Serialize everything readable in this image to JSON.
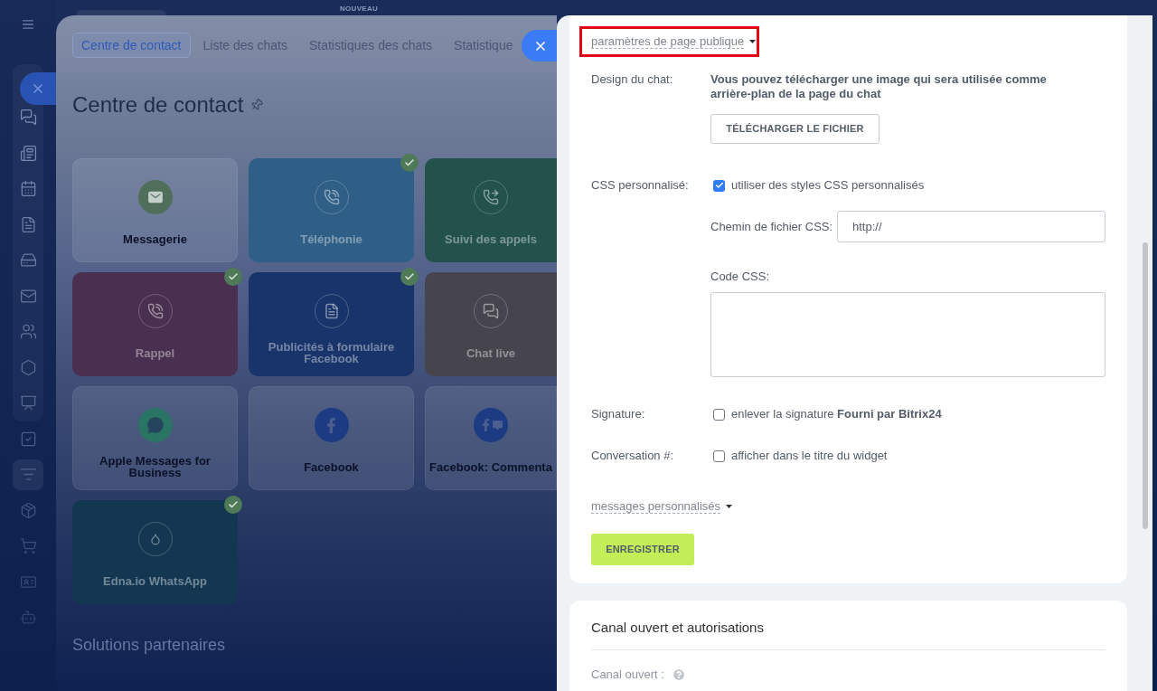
{
  "top_bar": {
    "badge": "NOUVEAU"
  },
  "sidebar": {
    "groups": [
      {
        "kind": "panel",
        "items": [
          {
            "selected": false
          },
          {
            "selected": false
          },
          {
            "selected": false
          },
          {
            "selected": false
          },
          {
            "selected": false
          },
          {
            "selected": false
          },
          {
            "selected": false
          },
          {
            "selected": false
          },
          {
            "selected": false
          }
        ]
      },
      {
        "kind": "plain",
        "items": [
          {
            "selected": false
          },
          {
            "selected": true
          },
          {
            "selected": false
          },
          {
            "selected": false
          },
          {
            "selected": false
          },
          {
            "selected": false
          }
        ]
      }
    ]
  },
  "contact_center": {
    "tabs": [
      {
        "label": "Centre de contact",
        "selected": true
      },
      {
        "label": "Liste des chats",
        "selected": false
      },
      {
        "label": "Statistiques des chats",
        "selected": false
      },
      {
        "label": "Statistique",
        "selected": false
      }
    ],
    "title": "Centre de contact",
    "tiles": [
      {
        "label": "Messagerie",
        "kind": "plain",
        "color": "#4f6f5b",
        "connected": false
      },
      {
        "label": "Téléphonie",
        "kind": "filled",
        "color": "#2f5e86",
        "connected": true
      },
      {
        "label": "Suivi des appels",
        "kind": "filled",
        "color": "#22524b",
        "connected": false
      },
      {
        "label": "Rappel",
        "kind": "filled",
        "color": "#4a3050",
        "connected": true
      },
      {
        "label": "Publicités à formulaire Facebook",
        "kind": "filled",
        "color": "#19346a",
        "connected": true
      },
      {
        "label": "Chat live",
        "kind": "filled",
        "color": "#46454e",
        "connected": false
      },
      {
        "label": "Apple Messages for Business",
        "kind": "plain",
        "color": "#2a7463",
        "connected": false
      },
      {
        "label": "Facebook",
        "kind": "plain",
        "color": "#1d3b82",
        "connected": false
      },
      {
        "label": "Facebook: Commenta",
        "kind": "plain",
        "color": "#1d3b82",
        "connected": false
      },
      {
        "label": "Edna.io WhatsApp",
        "kind": "filled",
        "color": "#133651",
        "connected": true
      }
    ],
    "section_title": "Solutions partenaires"
  },
  "settings": {
    "section_toggle": {
      "label": "paramètres de page publique",
      "highlighted": true
    },
    "design": {
      "label": "Design du chat:",
      "text": "Vous pouvez télécharger une image qui sera utilisée comme arrière-plan de la page du chat",
      "button": "TÉLÉCHARGER LE FICHIER"
    },
    "custom_css": {
      "label": "CSS personnalisé:",
      "option": "utiliser des styles CSS personnalisés",
      "checked": true,
      "file_path": {
        "label": "Chemin de fichier CSS:",
        "value": "http://"
      },
      "code": {
        "label": "Code CSS:"
      }
    },
    "options": [
      {
        "label": "Signature:",
        "option": "enlever la signature **Fourni par Bitrix24**",
        "checked": false
      },
      {
        "label": "Conversation #:",
        "option": "afficher dans le titre du widget",
        "checked": false
      }
    ],
    "messages_toggle": {
      "label": "messages personnalisés"
    },
    "save_button": "ENREGISTRER"
  },
  "open_channel": {
    "title": "Canal ouvert et autorisations",
    "field_label": "Canal ouvert :"
  }
}
